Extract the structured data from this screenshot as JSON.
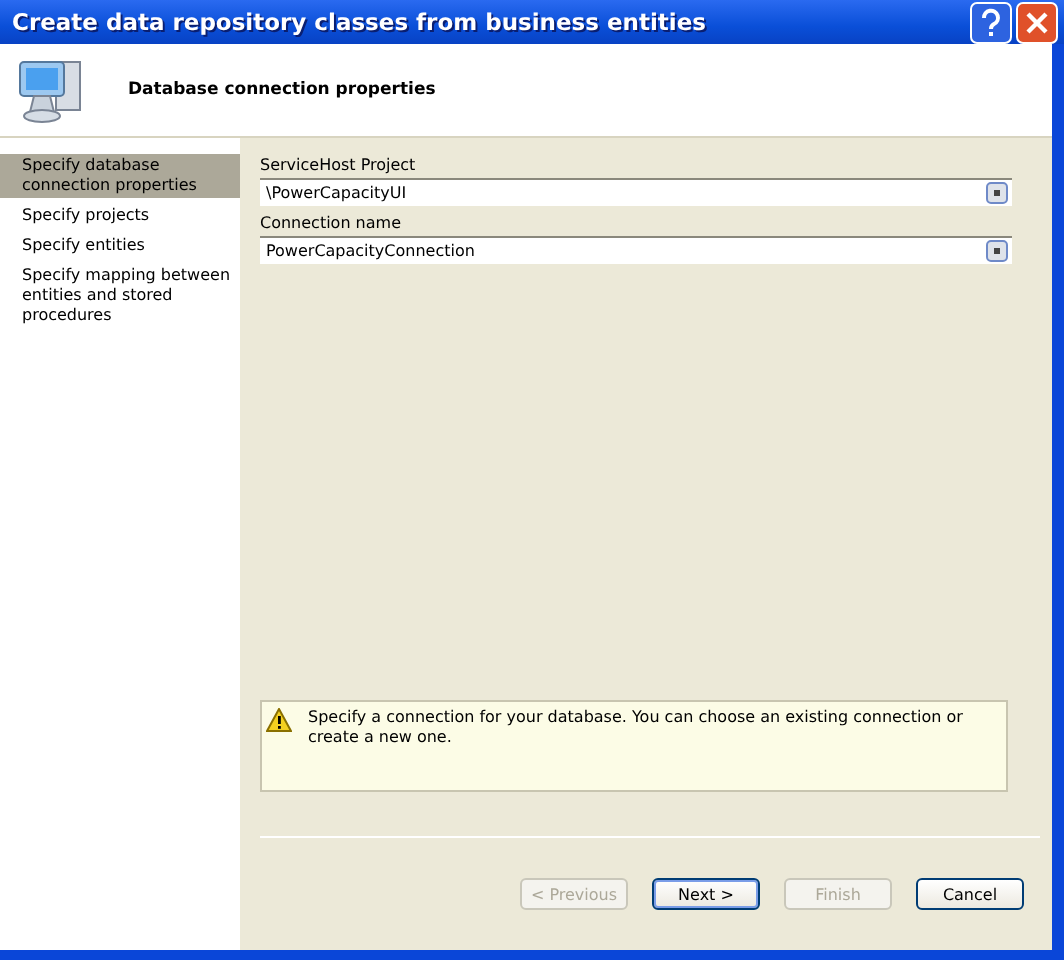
{
  "window": {
    "title": "Create data repository classes from business entities"
  },
  "header": {
    "title": "Database connection properties"
  },
  "sidebar": {
    "items": [
      {
        "label": "Specify database connection properties",
        "selected": true
      },
      {
        "label": "Specify projects",
        "selected": false
      },
      {
        "label": "Specify entities",
        "selected": false
      },
      {
        "label": "Specify mapping between entities and stored procedures",
        "selected": false
      }
    ]
  },
  "fields": [
    {
      "label": "ServiceHost Project",
      "value": "\\PowerCapacityUI"
    },
    {
      "label": "Connection name",
      "value": "PowerCapacityConnection"
    }
  ],
  "info": {
    "text": "Specify a connection for your database. You can choose an existing connection or create a new one."
  },
  "buttons": [
    {
      "label": "< Previous",
      "disabled": true
    },
    {
      "label": "Next >",
      "disabled": false
    },
    {
      "label": "Finish",
      "disabled": true
    },
    {
      "label": "Cancel",
      "disabled": false
    }
  ]
}
